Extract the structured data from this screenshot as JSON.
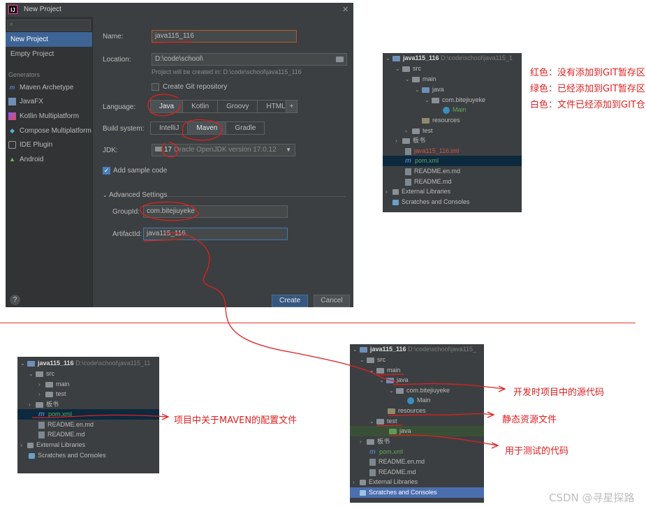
{
  "dialog": {
    "title": "New Project",
    "sidebar": {
      "items": [
        {
          "label": "New Project",
          "selected": true
        },
        {
          "label": "Empty Project",
          "selected": false
        }
      ],
      "generators_header": "Generators",
      "generators": [
        {
          "label": "Maven Archetype",
          "icon": "maven-icon"
        },
        {
          "label": "JavaFX",
          "icon": "javafx-icon"
        },
        {
          "label": "Kotlin Multiplatform",
          "icon": "kotlin-icon"
        },
        {
          "label": "Compose Multiplatform",
          "icon": "compose-icon"
        },
        {
          "label": "IDE Plugin",
          "icon": "plugin-icon"
        },
        {
          "label": "Android",
          "icon": "android-icon"
        }
      ]
    },
    "name_label": "Name:",
    "name_value": "java115_116",
    "location_label": "Location:",
    "location_value": "D:\\code\\school\\",
    "location_hint": "Project will be created in: D:\\code\\school\\java115_116",
    "git_label": "Create Git repository",
    "language_label": "Language:",
    "languages": [
      "Java",
      "Kotlin",
      "Groovy",
      "HTML"
    ],
    "language_selected": "Java",
    "add_language": "+",
    "build_label": "Build system:",
    "build_systems": [
      "IntelliJ",
      "Maven",
      "Gradle"
    ],
    "build_selected": "Maven",
    "jdk_label": "JDK:",
    "jdk_version": "17",
    "jdk_name": "Oracle OpenJDK version 17.0.12",
    "sample_label": "Add sample code",
    "advanced_label": "Advanced Settings",
    "groupid_label": "GroupId:",
    "groupid_value": "com.bitejiuyeke",
    "artifactid_label": "ArtifactId:",
    "artifactid_value": "java115_116",
    "create_button": "Create",
    "cancel_button": "Cancel",
    "help": "?"
  },
  "tree_right": {
    "root_name": "java115_116",
    "root_path": "D:\\code\\school\\java115_1",
    "rows": [
      "src",
      "main",
      "java",
      "com.bitejiuyeke",
      "Main",
      "resources",
      "test",
      "板书",
      "java115_116.iml",
      "pom.xml",
      "README.en.md",
      "README.md",
      "External Libraries",
      "Scratches and Consoles"
    ]
  },
  "legend": {
    "red": "红色：没有添加到GIT暂存区",
    "green": "绿色：已经添加到GIT暂存区",
    "white": "白色：文件已经添加到GIT仓"
  },
  "tree_left": {
    "root_name": "java115_116",
    "root_path": "D:\\code\\school\\java115_11",
    "rows": [
      "src",
      "main",
      "test",
      "板书",
      "pom.xml",
      "README.en.md",
      "README.md",
      "External Libraries",
      "Scratches and Consoles"
    ],
    "annotation": "项目中关于MAVEN的配置文件"
  },
  "tree_bottom": {
    "root_name": "java115_116",
    "root_path": "D:\\code\\school\\java115_",
    "rows": [
      "src",
      "main",
      "java",
      "com.bitejiuyeke",
      "Main",
      "resources",
      "test",
      "java",
      "板书",
      "pom.xml",
      "README.en.md",
      "README.md",
      "External Libraries",
      "Scratches and Consoles"
    ],
    "annotations": {
      "source": "开发时项目中的源代码",
      "resources": "静态资源文件",
      "test": "用于测试的代码"
    }
  },
  "watermark": "CSDN @寻星探路",
  "colors": {
    "annotation": "#e02020",
    "ide_bg": "#3c3f41",
    "selection": "#4b6eaf"
  }
}
